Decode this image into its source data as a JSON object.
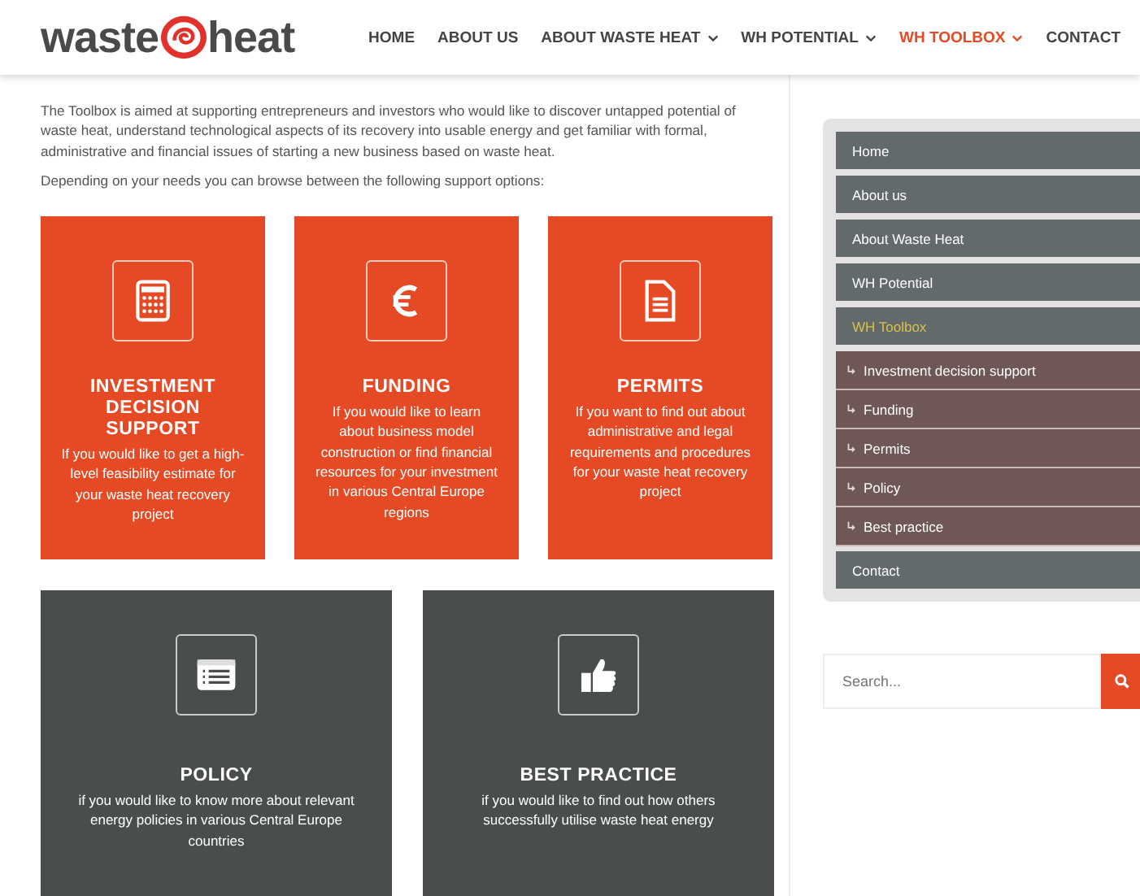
{
  "nav": [
    {
      "label": "HOME",
      "dropdown": false,
      "selected": false
    },
    {
      "label": "ABOUT US",
      "dropdown": false,
      "selected": false
    },
    {
      "label": "ABOUT WASTE HEAT",
      "dropdown": true,
      "selected": false
    },
    {
      "label": "WH POTENTIAL",
      "dropdown": true,
      "selected": false
    },
    {
      "label": "WH TOOLBOX",
      "dropdown": true,
      "selected": true
    },
    {
      "label": "CONTACT",
      "dropdown": false,
      "selected": false
    }
  ],
  "logo": {
    "left": "waste",
    "right": "heat"
  },
  "intro": [
    "The Toolbox is aimed at supporting entrepreneurs and investors who would like to discover untapped potential of waste heat, understand technological aspects of its recovery into usable energy and get familiar with formal, administrative and financial issues of starting a new business based on waste heat.",
    "Depending on your needs you can browse between the following support options:"
  ],
  "cards": [
    {
      "kind": "calculator",
      "color": "#e54a24",
      "title": "INVESTMENT DECISION SUPPORT",
      "text": "If you would like to get a high-level feasibility estimate for your waste heat recovery project"
    },
    {
      "kind": "euro",
      "color": "#e54a24",
      "title": "FUNDING",
      "text": "If you would like to learn about business model construction or find financial resources for your investment in various Central Europe regions"
    },
    {
      "kind": "document",
      "color": "#e54a24",
      "title": "PERMITS",
      "text": "If you want to find out about administrative and legal requirements and procedures for your waste heat recovery project"
    },
    {
      "kind": "list",
      "color": "#4a4d4e",
      "title": "POLICY",
      "text": "if you would like to know more about relevant energy policies in various Central Europe countries"
    },
    {
      "kind": "thumbs-up",
      "color": "#4a4d4e",
      "title": "BEST PRACTICE",
      "text": "if you would like to find out how others successfully utilise waste heat energy"
    }
  ],
  "sidebar": {
    "items": [
      {
        "kind": "item",
        "label": "Home",
        "selected": false
      },
      {
        "kind": "item",
        "label": "About us",
        "selected": false
      },
      {
        "kind": "item",
        "label": "About Waste Heat",
        "selected": false
      },
      {
        "kind": "item",
        "label": "WH Potential",
        "selected": false
      },
      {
        "kind": "item",
        "label": "WH Toolbox",
        "selected": true
      },
      {
        "kind": "subitem",
        "label": "Investment decision support",
        "selected": false
      },
      {
        "kind": "subitem",
        "label": "Funding",
        "selected": false
      },
      {
        "kind": "subitem",
        "label": "Permits",
        "selected": false
      },
      {
        "kind": "subitem",
        "label": "Policy",
        "selected": false
      },
      {
        "kind": "subitem",
        "label": "Best practice",
        "selected": false
      },
      {
        "kind": "item",
        "label": "Contact",
        "selected": false
      }
    ]
  },
  "search": {
    "placeholder": "Search..."
  }
}
